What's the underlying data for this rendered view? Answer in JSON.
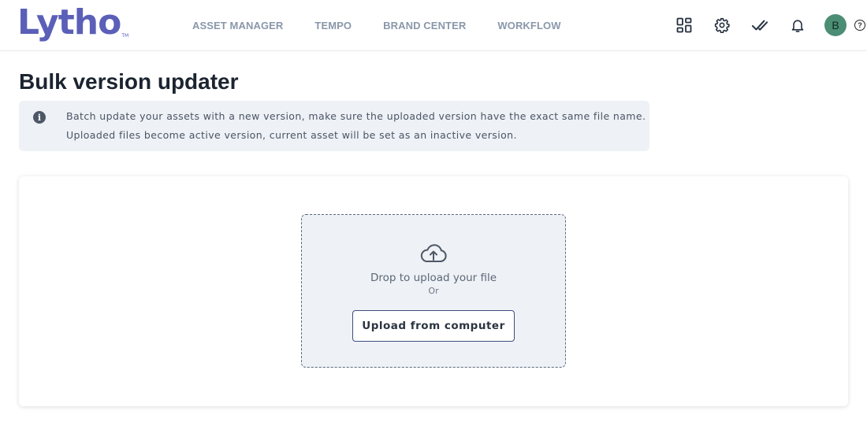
{
  "brand": {
    "logo_text": "Lytho",
    "logo_tm": "TM",
    "color": "#5b5fb8"
  },
  "nav": [
    {
      "label": "ASSET MANAGER"
    },
    {
      "label": "TEMPO"
    },
    {
      "label": "BRAND CENTER"
    },
    {
      "label": "WORKFLOW"
    }
  ],
  "header_icons": [
    "apps-grid-icon",
    "settings-gear-icon",
    "tasks-double-check-icon",
    "notifications-bell-icon"
  ],
  "user": {
    "avatar_initial": "B",
    "avatar_color": "#4c8d75"
  },
  "help": {
    "label": "?"
  },
  "page": {
    "title": "Bulk version updater",
    "info": {
      "icon": "i",
      "line1": "Batch update your assets with a new version, make sure the uploaded version have the exact same file name.",
      "line2": "Uploaded files become active version, current asset will be set as an inactive version."
    }
  },
  "upload": {
    "icon": "cloud-upload-icon",
    "drop_text": "Drop to upload your file",
    "or_text": "Or",
    "button_label": "Upload from computer"
  }
}
